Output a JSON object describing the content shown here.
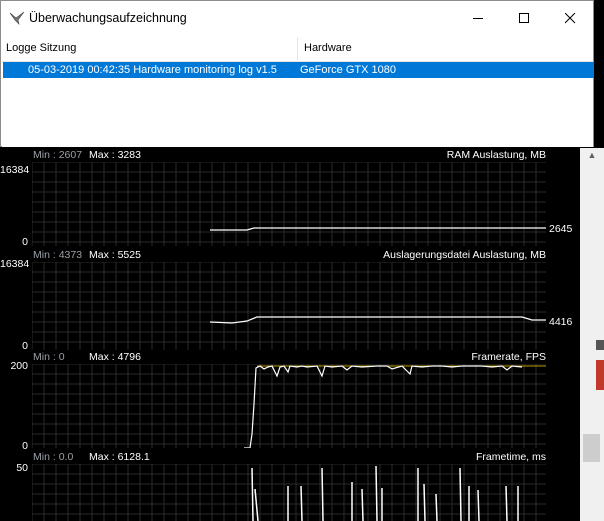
{
  "dialog": {
    "title": "Überwachungsaufzeichnung",
    "columns": [
      "Logge Sitzung",
      "Hardware"
    ],
    "rows": [
      {
        "session": "05-03-2019 00:42:35 Hardware monitoring log v1.5",
        "hardware": "GeForce GTX 1080",
        "selected": true
      }
    ]
  },
  "graphs": [
    {
      "title": "RAM Auslastung, MB",
      "min_label": "Min :",
      "min": "2607",
      "max_label": "Max :",
      "max": "3283",
      "axis_top": "16384",
      "axis_bottom": "0",
      "current": "2645"
    },
    {
      "title": "Auslagerungsdatei Auslastung, MB",
      "min_label": "Min :",
      "min": "4373",
      "max_label": "Max :",
      "max": "5525",
      "axis_top": "16384",
      "axis_bottom": "0",
      "current": "4416"
    },
    {
      "title": "Framerate, FPS",
      "min_label": "Min :",
      "min": "0",
      "max_label": "Max :",
      "max": "4796",
      "axis_top": "200",
      "axis_bottom": "0",
      "current": ""
    },
    {
      "title": "Frametime, ms",
      "min_label": "Min :",
      "min": "0.0",
      "max_label": "Max :",
      "max": "6128.1",
      "axis_top": "50",
      "axis_bottom": "",
      "current": ""
    }
  ],
  "colors": {
    "selection": "#0078d7",
    "graph_bg": "#000000",
    "grid": "#2a2a2a",
    "trace": "#ffffff",
    "fps_limit": "#b8a000"
  }
}
